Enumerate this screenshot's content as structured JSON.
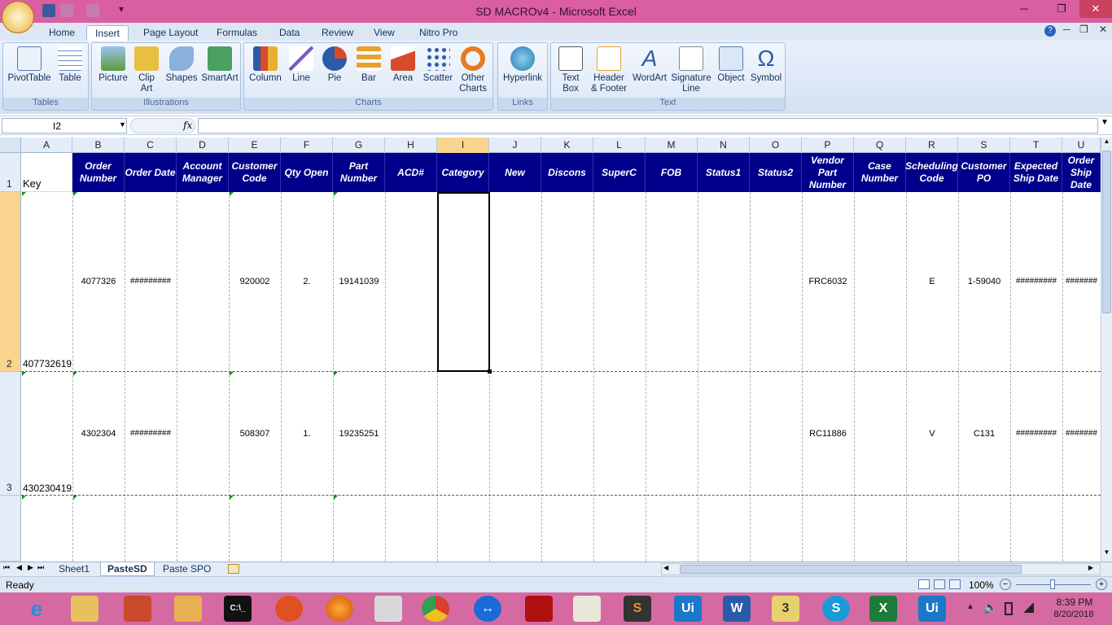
{
  "window": {
    "title": "SD MACROv4 - Microsoft Excel"
  },
  "ribbon": {
    "tabs": [
      "Home",
      "Insert",
      "Page Layout",
      "Formulas",
      "Data",
      "Review",
      "View",
      "Nitro Pro"
    ],
    "active_tab": "Insert",
    "groups": [
      {
        "title": "Tables",
        "buttons": [
          "PivotTable",
          "Table"
        ]
      },
      {
        "title": "Illustrations",
        "buttons": [
          "Picture",
          "Clip Art",
          "Shapes",
          "SmartArt"
        ]
      },
      {
        "title": "Charts",
        "buttons": [
          "Column",
          "Line",
          "Pie",
          "Bar",
          "Area",
          "Scatter",
          "Other Charts"
        ]
      },
      {
        "title": "Links",
        "buttons": [
          "Hyperlink"
        ]
      },
      {
        "title": "Text",
        "buttons": [
          "Text Box",
          "Header & Footer",
          "WordArt",
          "Signature Line",
          "Object",
          "Symbol"
        ]
      }
    ]
  },
  "formula_bar": {
    "name_box": "I2",
    "fx": "fx",
    "value": ""
  },
  "columns": [
    "A",
    "B",
    "C",
    "D",
    "E",
    "F",
    "G",
    "H",
    "I",
    "J",
    "K",
    "L",
    "M",
    "N",
    "O",
    "P",
    "Q",
    "R",
    "S",
    "T",
    "U"
  ],
  "selected_column": "I",
  "headers": {
    "A": "Key",
    "B": "Order Number",
    "C": "Order Date",
    "D": "Account Manager",
    "E": "Customer Code",
    "F": "Qty Open",
    "G": "Part Number",
    "H": "ACD#",
    "I": "Category",
    "J": "New",
    "K": "Discons",
    "L": "SuperC",
    "M": "FOB",
    "N": "Status1",
    "O": "Status2",
    "P": "Vendor Part Number",
    "Q": "Case Number",
    "R": "Scheduling Code",
    "S": "Customer PO",
    "T": "Expected Ship Date",
    "U": "Order Ship Date"
  },
  "rows": [
    {
      "num": "1"
    },
    {
      "num": "2",
      "A": "407732619",
      "B": "4077326",
      "C": "#########",
      "E": "920002",
      "F": "2.",
      "G": "19141039",
      "P": "FRC6032",
      "R": "E",
      "S": "1-59040",
      "T": "#########",
      "U": "#######"
    },
    {
      "num": "3",
      "A": "430230419",
      "B": "4302304",
      "C": "#########",
      "E": "508307",
      "F": "1.",
      "G": "19235251",
      "P": "RC11886",
      "R": "V",
      "S": "C131",
      "T": "#########",
      "U": "#######"
    }
  ],
  "sheet_tabs": [
    "Sheet1",
    "PasteSD",
    "Paste SPO"
  ],
  "active_sheet": "PasteSD",
  "status": {
    "text": "Ready",
    "zoom": "100%"
  },
  "taskbar": {
    "time": "8:39 PM",
    "date": "8/20/2018",
    "pinned": [
      "ie-icon",
      "explorer-icon",
      "folder-app-icon",
      "outlook-icon",
      "cmd-icon",
      "tools-icon",
      "firefox-icon",
      "calculator-icon",
      "chrome-icon",
      "teamviewer-icon",
      "acrobat-icon",
      "sheets-app-icon",
      "sublime-icon",
      "uipath-icon",
      "word-icon",
      "media-icon",
      "skype-icon",
      "excel-icon",
      "uipath-studio-icon"
    ]
  }
}
